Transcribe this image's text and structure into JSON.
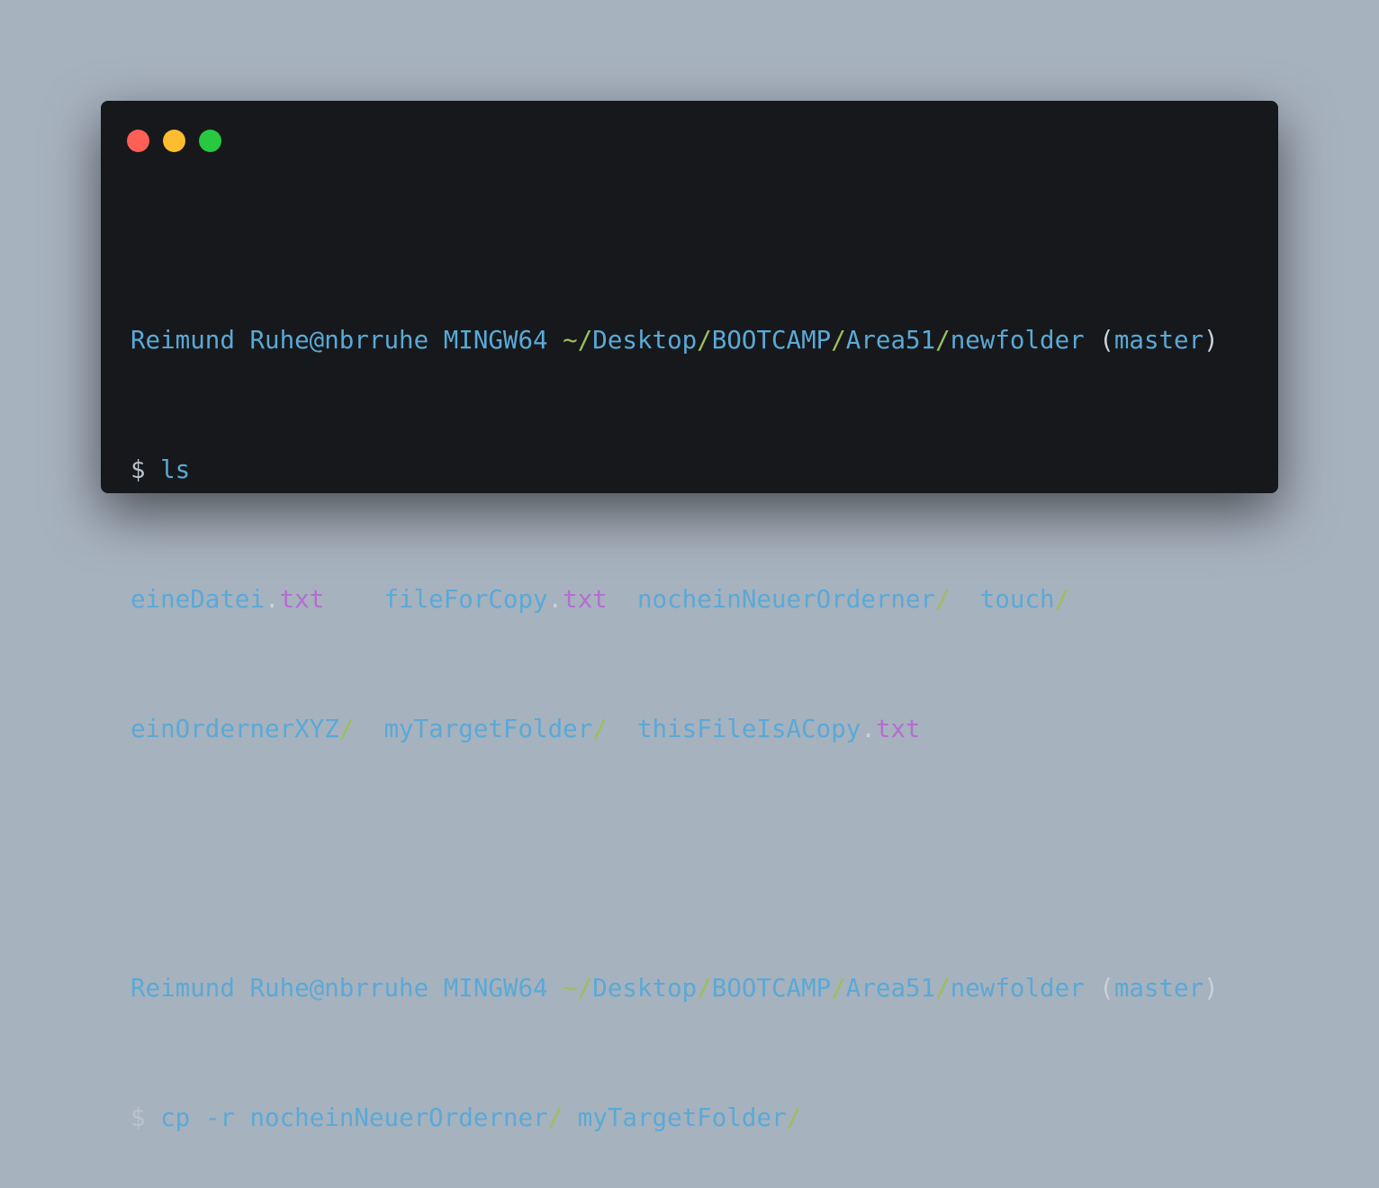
{
  "window": {
    "controls": {
      "close_icon": "close-dot-icon",
      "minimize_icon": "minimize-dot-icon",
      "maximize_icon": "maximize-dot-icon",
      "colors": {
        "close": "#ff5f57",
        "minimize": "#febc2e",
        "maximize": "#28c840"
      }
    }
  },
  "terminal": {
    "colors": {
      "text": "#5aa9d6",
      "slash_and_tilde": "#9bc05a",
      "extension": "#b36fcf",
      "background": "#16181b"
    },
    "prompt1": {
      "user": "Reimund Ruhe@nbrruhe",
      "shell": "MINGW64",
      "tilde": "~",
      "path_parts": [
        "/",
        "Desktop",
        "/",
        "BOOTCAMP",
        "/",
        "Area51",
        "/",
        "newfolder"
      ],
      "branch_open": "(",
      "branch": "master",
      "branch_close": ")"
    },
    "command1": {
      "symbol": "$",
      "text": "ls"
    },
    "listing": {
      "row1": [
        {
          "name": "eineDatei",
          "dot": ".",
          "ext": "txt",
          "pad": "    "
        },
        {
          "name": "fileForCopy",
          "dot": ".",
          "ext": "txt",
          "pad": "  "
        },
        {
          "name": "nocheinNeuerOrderner",
          "slash": "/",
          "pad": "  "
        },
        {
          "name": "touch",
          "slash": "/"
        }
      ],
      "row2": [
        {
          "name": "einOrdernerXYZ",
          "slash": "/",
          "pad": "  "
        },
        {
          "name": "myTargetFolder",
          "slash": "/",
          "pad": "  "
        },
        {
          "name": "thisFileIsACopy",
          "dot": ".",
          "ext": "txt"
        }
      ]
    },
    "prompt2": {
      "user": "Reimund Ruhe@nbrruhe",
      "shell": "MINGW64",
      "tilde": "~",
      "path_parts": [
        "/",
        "Desktop",
        "/",
        "BOOTCAMP",
        "/",
        "Area51",
        "/",
        "newfolder"
      ],
      "branch_open": "(",
      "branch": "master",
      "branch_close": ")"
    },
    "command2": {
      "symbol": "$",
      "cmd": "cp",
      "flag": "-r",
      "src": "nocheinNeuerOrderner",
      "src_slash": "/",
      "dst": "myTargetFolder",
      "dst_slash": "/"
    }
  }
}
